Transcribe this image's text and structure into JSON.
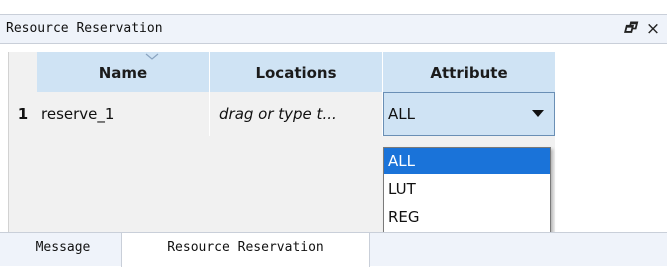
{
  "panel": {
    "title": "Resource Reservation",
    "float_icon": "restore-window-icon",
    "float_glyph": "🗗",
    "close_icon": "close-icon",
    "close_glyph": "×"
  },
  "table": {
    "columns": [
      "Name",
      "Locations",
      "Attribute"
    ],
    "rows": [
      {
        "row_number": "1",
        "name": "reserve_1",
        "locations": "drag or type t...",
        "attribute": "ALL"
      }
    ]
  },
  "dropdown": {
    "options": [
      "ALL",
      "LUT",
      "REG"
    ],
    "selected": "ALL"
  },
  "tabs": [
    {
      "label": "Message",
      "active": false
    },
    {
      "label": "Resource Reservation",
      "active": true
    }
  ],
  "colors": {
    "header_bg": "#cfe3f4",
    "selected_bg": "#1a73d9",
    "grid_bg": "#f1f1f1"
  }
}
